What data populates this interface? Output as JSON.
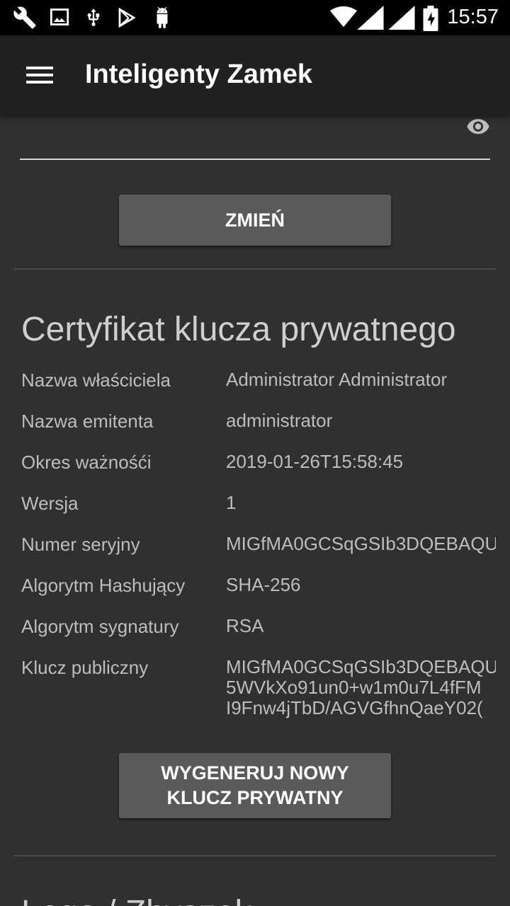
{
  "status_bar": {
    "time": "15:57",
    "left_icons": [
      "wrench-icon",
      "image-icon",
      "usb-icon",
      "play-store-icon",
      "android-icon"
    ],
    "right_icons": [
      "wifi-icon",
      "signal-icon",
      "signal-icon",
      "battery-charging-icon"
    ]
  },
  "app_bar": {
    "title": "Inteligenty Zamek",
    "menu_icon": "menu-icon"
  },
  "password_section": {
    "visibility_icon": "eye-icon",
    "change_button": "ZMIEŃ"
  },
  "certificate": {
    "title": "Certyfikat klucza prywatnego",
    "rows": [
      {
        "label": "Nazwa właściciela",
        "value": "Administrator Administrator"
      },
      {
        "label": "Nazwa emitenta",
        "value": "administrator"
      },
      {
        "label": "Okres ważnośći",
        "value": "2019-01-26T15:58:45"
      },
      {
        "label": "Wersja",
        "value": "1"
      },
      {
        "label": "Numer seryjny",
        "value": "MIGfMA0GCSqGSIb3DQEBAQU"
      },
      {
        "label": "Algorytm Hashujący",
        "value": "SHA-256"
      },
      {
        "label": "Algorytm sygnatury",
        "value": "RSA"
      },
      {
        "label": "Klucz publiczny",
        "value_lines": [
          "MIGfMA0GCSqGSIb3DQEBAQU",
          "5WVkXo91un0+w1m0u7L4fFM",
          "I9Fnw4jTbD/AGVGfhnQaeY02("
        ]
      }
    ],
    "generate_button_line1": "WYGENERUJ NOWY",
    "generate_button_line2": "KLUCZ PRYWATNY"
  },
  "next_section": {
    "title_partial": "Logo / Zbyszek"
  },
  "colors": {
    "background": "#303030",
    "app_bar": "#212121",
    "button": "#5a5a5a",
    "text": "#bdbdbd"
  }
}
